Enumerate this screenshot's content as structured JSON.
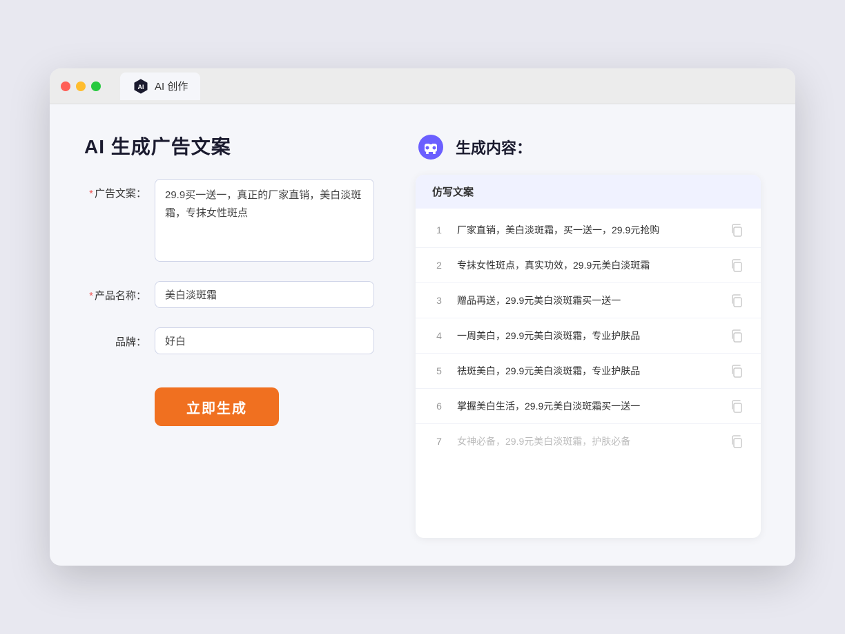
{
  "titlebar": {
    "tab_label": "AI 创作"
  },
  "left": {
    "title": "AI 生成广告文案",
    "ad_copy_label": "广告文案：",
    "ad_copy_required": "*",
    "ad_copy_value": "29.9买一送一，真正的厂家直销，美白淡斑霜，专抹女性斑点",
    "product_name_label": "产品名称：",
    "product_name_required": "*",
    "product_name_value": "美白淡斑霜",
    "brand_label": "品牌：",
    "brand_value": "好白",
    "generate_button": "立即生成"
  },
  "right": {
    "title": "生成内容：",
    "column_header": "仿写文案",
    "results": [
      {
        "num": "1",
        "text": "厂家直销，美白淡斑霜，买一送一，29.9元抢购"
      },
      {
        "num": "2",
        "text": "专抹女性斑点，真实功效，29.9元美白淡斑霜"
      },
      {
        "num": "3",
        "text": "赠品再送，29.9元美白淡斑霜买一送一"
      },
      {
        "num": "4",
        "text": "一周美白，29.9元美白淡斑霜，专业护肤品"
      },
      {
        "num": "5",
        "text": "祛斑美白，29.9元美白淡斑霜，专业护肤品"
      },
      {
        "num": "6",
        "text": "掌握美白生活，29.9元美白淡斑霜买一送一"
      },
      {
        "num": "7",
        "text": "女神必备，29.9元美白淡斑霜，护肤必备",
        "faded": true
      }
    ]
  }
}
